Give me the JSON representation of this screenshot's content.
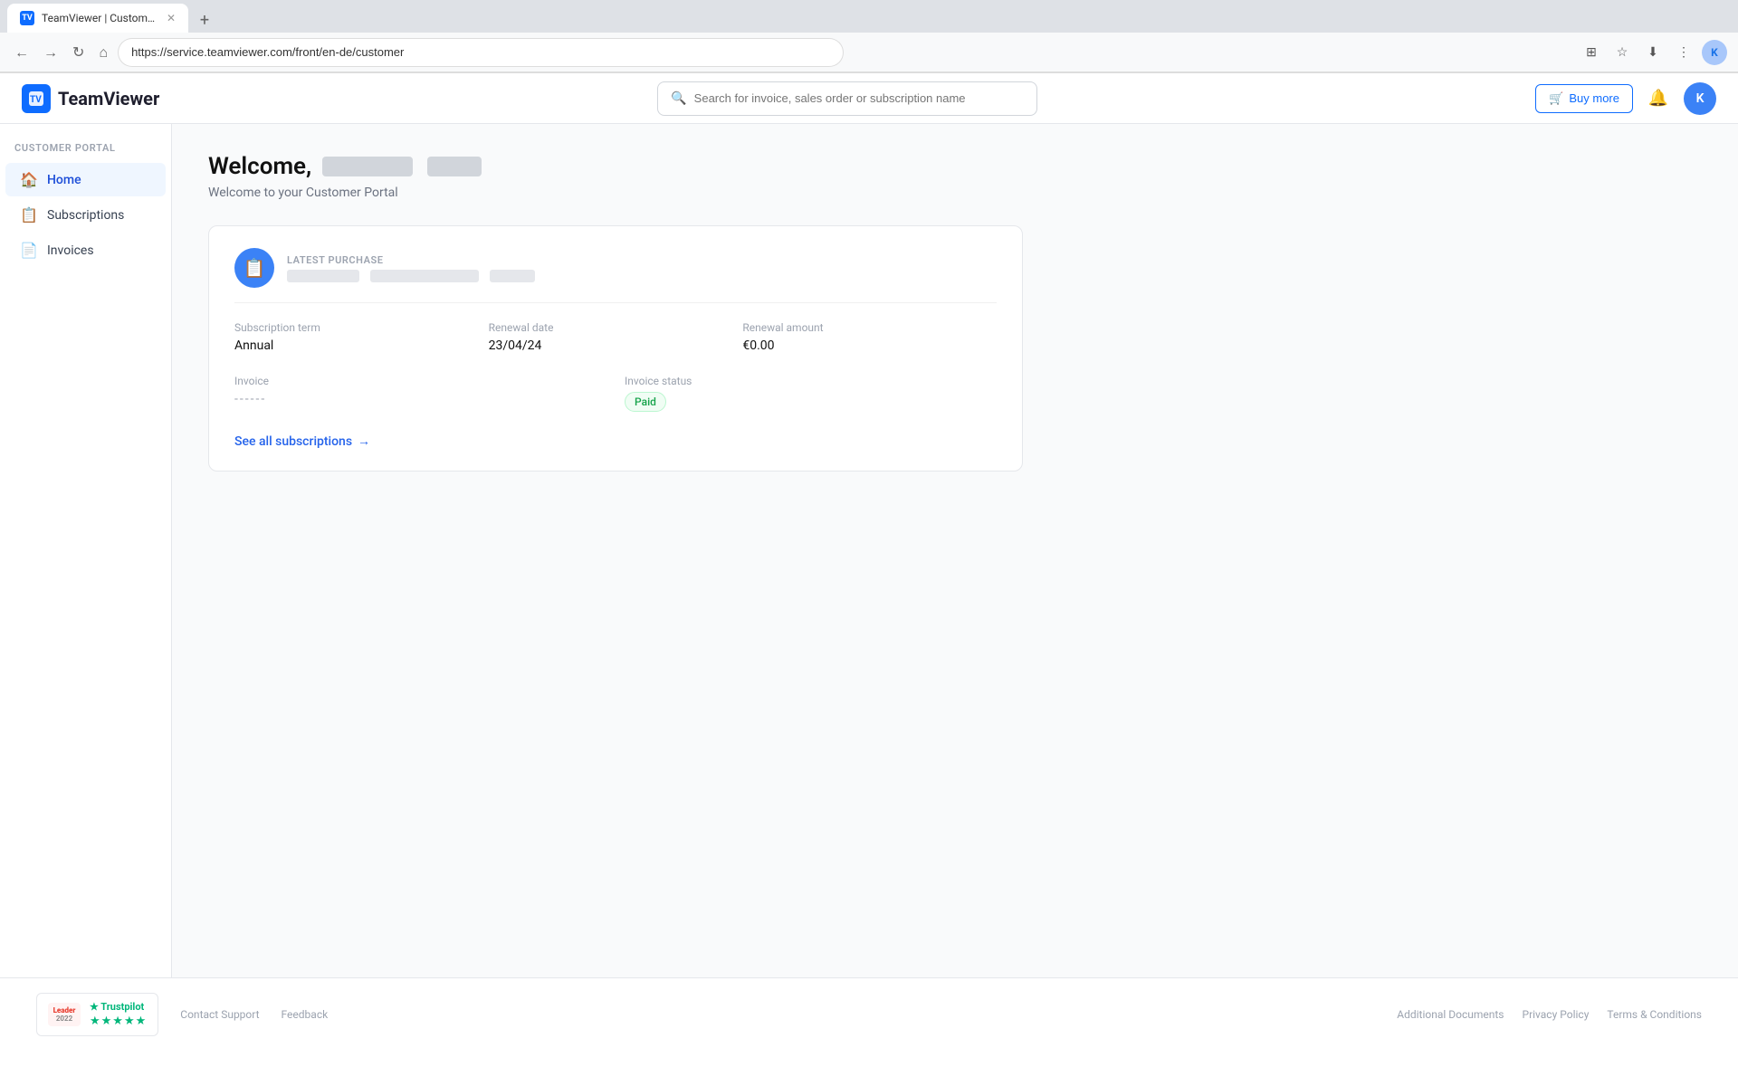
{
  "browser": {
    "tab_title": "TeamViewer | Customer Portal",
    "tab_favicon": "TV",
    "address_url": "https://service.teamviewer.com/front/en-de/customer",
    "new_tab_label": "+",
    "profile_initial": "K"
  },
  "header": {
    "logo_text": "TeamViewer",
    "search_placeholder": "Search for invoice, sales order or subscription name",
    "buy_more_label": "Buy more",
    "user_initial": "K"
  },
  "sidebar": {
    "section_label": "CUSTOMER PORTAL",
    "items": [
      {
        "label": "Home",
        "icon": "🏠",
        "active": true
      },
      {
        "label": "Subscriptions",
        "icon": "📋",
        "active": false
      },
      {
        "label": "Invoices",
        "icon": "📄",
        "active": false
      }
    ]
  },
  "main": {
    "welcome_heading": "Welcome,",
    "welcome_sub": "Welcome to your Customer Portal",
    "card": {
      "latest_purchase_label": "LATEST PURCHASE",
      "subscription_term_label": "Subscription term",
      "subscription_term_value": "Annual",
      "renewal_date_label": "Renewal date",
      "renewal_date_value": "23/04/24",
      "renewal_amount_label": "Renewal amount",
      "renewal_amount_value": "€0.00",
      "invoice_label": "Invoice",
      "invoice_value": "------",
      "invoice_status_label": "Invoice status",
      "invoice_status_value": "Paid",
      "see_all_label": "See all subscriptions",
      "arrow": "→"
    }
  },
  "footer": {
    "contact_support": "Contact Support",
    "feedback": "Feedback",
    "additional_documents": "Additional Documents",
    "privacy_policy": "Privacy Policy",
    "terms_conditions": "Terms & Conditions"
  },
  "trustpilot": {
    "leader_text": "Leader",
    "year_text": "2022",
    "logo_text": "★ Trustpilot",
    "stars": "★★★★★"
  }
}
